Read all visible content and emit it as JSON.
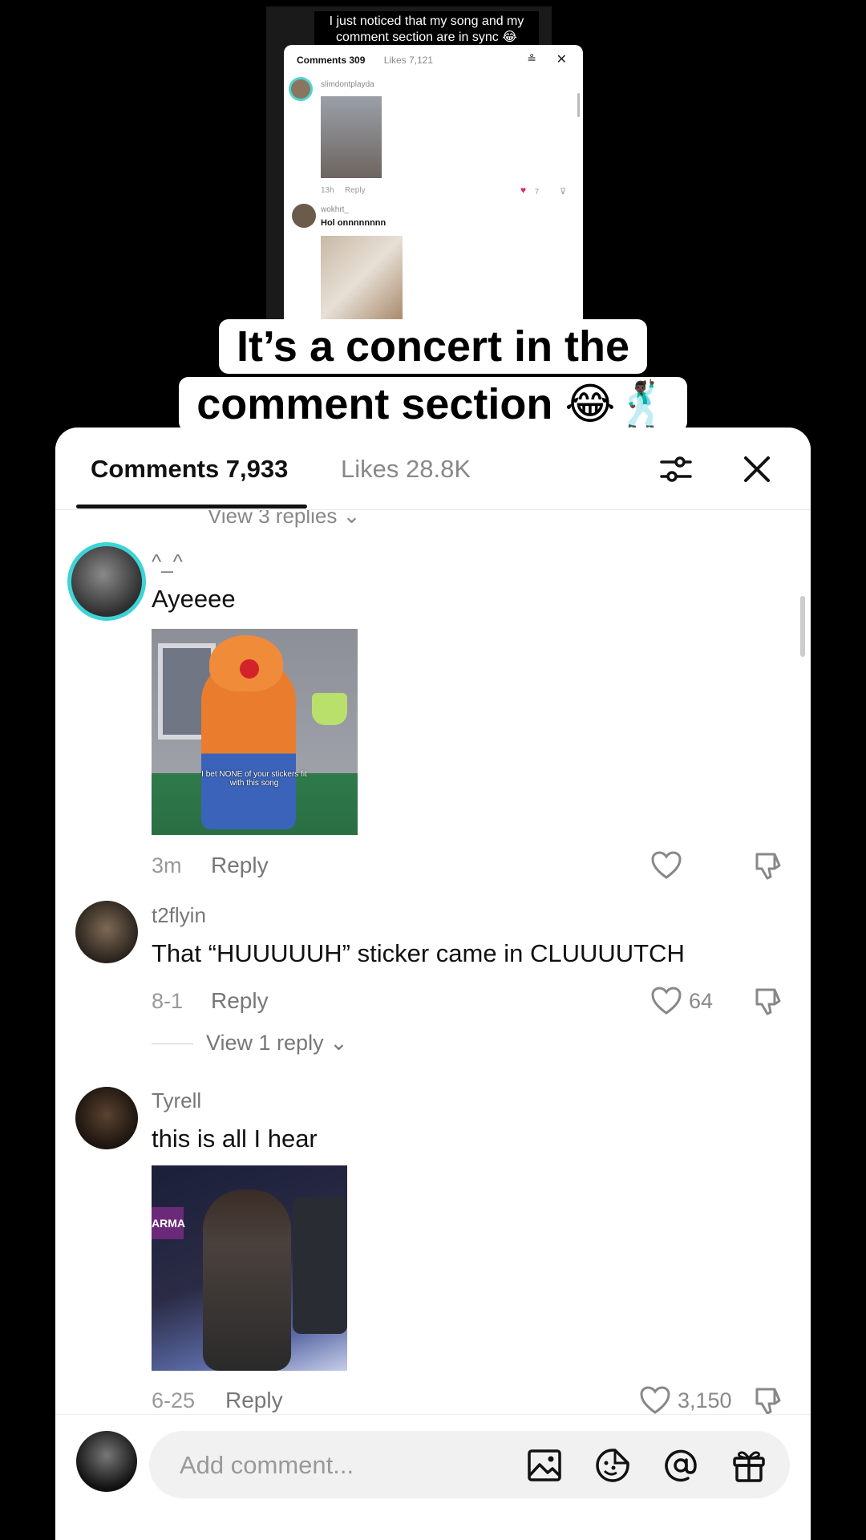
{
  "top_screenshot": {
    "caption": "I just noticed that my song and my comment section are in sync 😂",
    "tabs": {
      "comments": "Comments 309",
      "likes": "Likes 7,121"
    },
    "filter_icon": "≗",
    "close_icon": "✕",
    "comment1": {
      "user": "slimdontplayda",
      "time": "13h",
      "reply": "Reply",
      "likes": "7"
    },
    "comment2": {
      "user": "wokhrt_",
      "text": "Hol onnnnnnnn"
    }
  },
  "overlay": {
    "line1": "It’s a concert in the",
    "line2": "comment section 😂🕺🏿"
  },
  "sheet": {
    "tabs": {
      "comments": "Comments 7,933",
      "likes": "Likes 28.8K"
    },
    "cut_off_text": "View 3 replies ⌄",
    "comments": [
      {
        "user": "^_^",
        "text": "Ayeeee",
        "sticker_caption": "I bet NONE of your stickers fit with this song",
        "time": "3m",
        "reply": "Reply",
        "likes": ""
      },
      {
        "user": "t2flyin",
        "text": "That “HUUUUUH” sticker came in CLUUUUTCH",
        "time": "8-1",
        "reply": "Reply",
        "likes": "64",
        "view_replies": "View 1 reply ⌄"
      },
      {
        "user": "Tyrell",
        "text": "this is all I hear",
        "sticker_banner": "ARMA",
        "time": "6-25",
        "reply": "Reply",
        "likes": "3,150"
      }
    ],
    "input": {
      "placeholder": "Add comment..."
    },
    "colors": {
      "accent_ring": "#3ed3d6",
      "heart_red": "#e0245e"
    }
  }
}
